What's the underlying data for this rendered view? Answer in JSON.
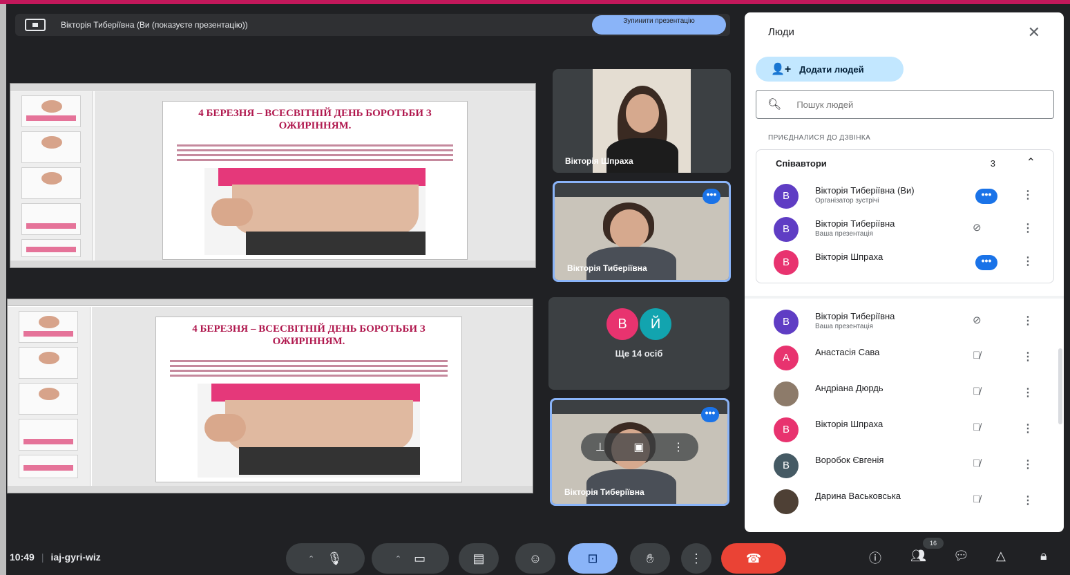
{
  "presentation_banner": {
    "text": "Вікторія Тиберіївна (Ви (показуєте презентацію))",
    "stop_label": "Зупинити презентацію"
  },
  "slide": {
    "title": "4 БЕРЕЗНЯ – ВСЕСВІТНІЙ ДЕНЬ БОРОТЬБИ З ОЖИРІННЯМ."
  },
  "tiles": [
    {
      "name": "Вікторія Шпраха"
    },
    {
      "name": "Вікторія Тиберіївна"
    },
    {
      "name": "Вікторія Тиберіївна"
    }
  ],
  "more_tile": {
    "avatars": [
      {
        "letter": "В",
        "color": "#e8336f"
      },
      {
        "letter": "Й",
        "color": "#12a4af"
      }
    ],
    "label": "Ще 14 осіб"
  },
  "people_panel": {
    "title": "Люди",
    "add_label": "Додати людей",
    "search_placeholder": "Пошук людей",
    "section_label": "ПРИЄДНАЛИСЯ ДО ДЗВІНКА",
    "cohosts": {
      "label": "Співавтори",
      "count": "3",
      "rows": [
        {
          "letter": "В",
          "color": "#5f3dc4",
          "name": "Вікторія Тиберіївна (Ви)",
          "sub": "Організатор зустрічі",
          "state": "speaking"
        },
        {
          "letter": "В",
          "color": "#5f3dc4",
          "name": "Вікторія Тиберіївна",
          "sub": "Ваша презентація",
          "state": "screen-off"
        },
        {
          "letter": "В",
          "color": "#e8336f",
          "name": "Вікторія Шпраха",
          "sub": "",
          "state": "speaking"
        }
      ]
    },
    "participants": [
      {
        "letter": "В",
        "color": "#5f3dc4",
        "name": "Вікторія Тиберіївна",
        "sub": "Ваша презентація",
        "state": "screen-off"
      },
      {
        "letter": "А",
        "color": "#e8336f",
        "name": "Анастасія Сава",
        "sub": "",
        "state": "muted"
      },
      {
        "letter": "",
        "color": "#8d7b6a",
        "name": "Андріана Дюрдь",
        "sub": "",
        "state": "muted"
      },
      {
        "letter": "В",
        "color": "#e8336f",
        "name": "Вікторія Шпраха",
        "sub": "",
        "state": "muted"
      },
      {
        "letter": "В",
        "color": "#455a64",
        "name": "Воробок Євгенія",
        "sub": "",
        "state": "muted"
      },
      {
        "letter": "",
        "color": "#4e4035",
        "name": "Дарина Васьковська",
        "sub": "",
        "state": "muted"
      }
    ]
  },
  "bottom_bar": {
    "time": "10:49",
    "meeting_code": "iaj-gyri-wiz",
    "people_count": "16"
  },
  "colors": {
    "accent": "#c2185b",
    "background": "#202124",
    "present_button": "#8ab4f8",
    "end_call": "#ea4335"
  }
}
